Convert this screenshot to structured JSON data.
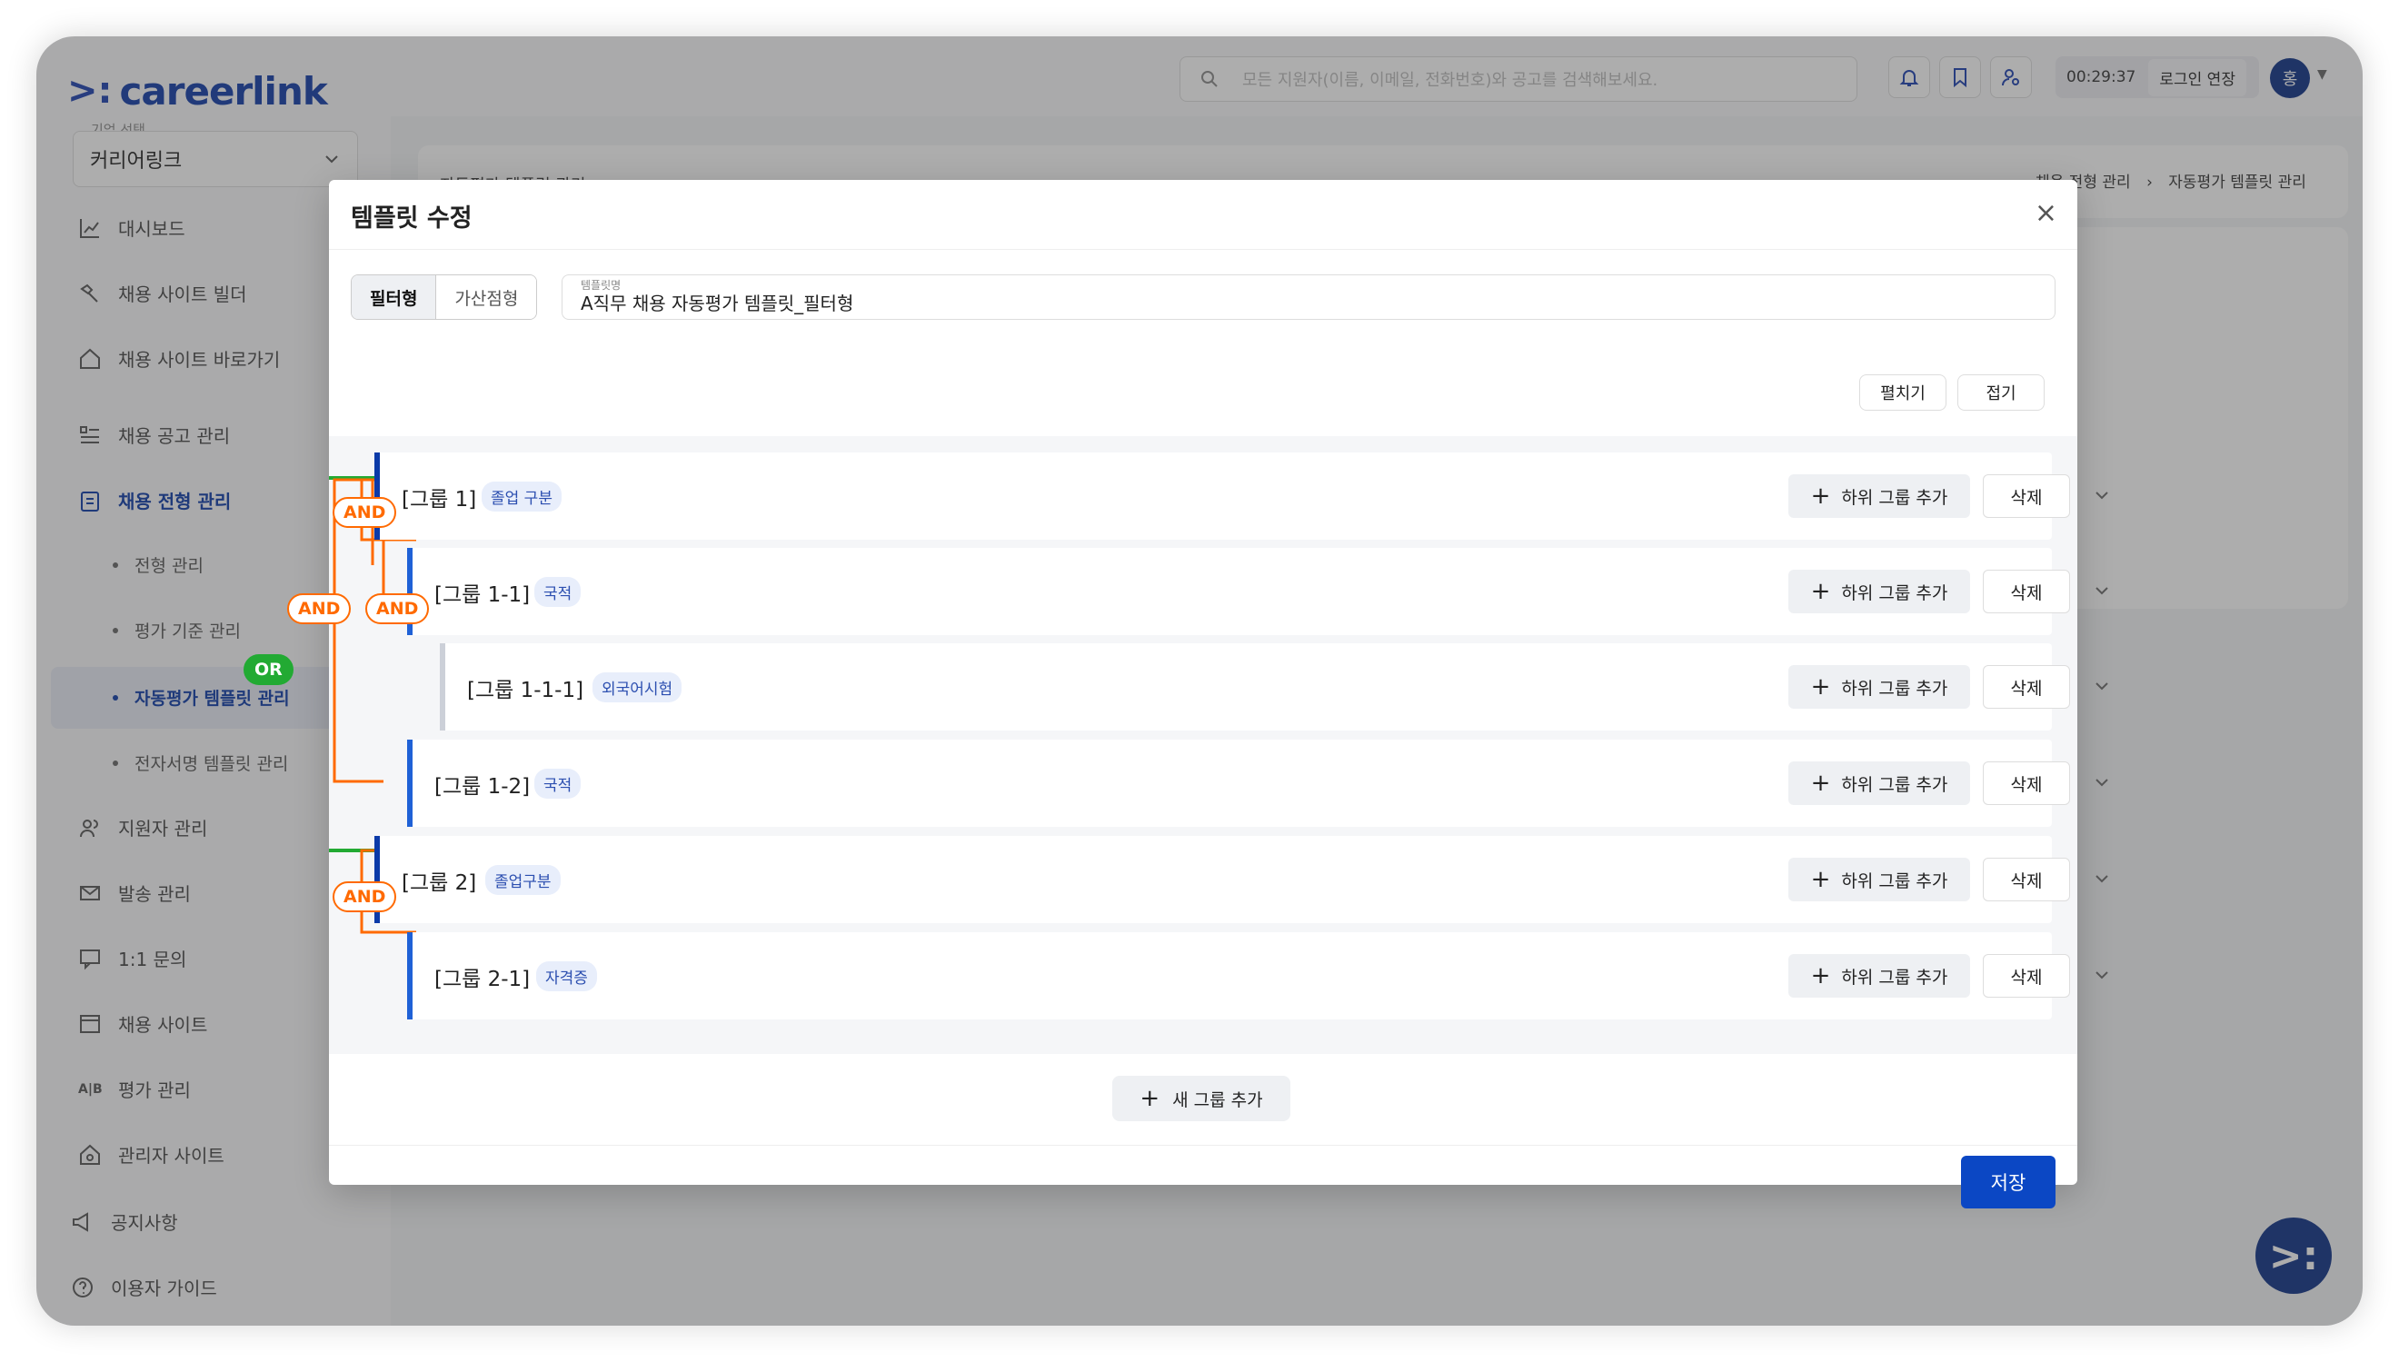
{
  "brand": {
    "logo_mark": ">:",
    "logo_text": "careerlink"
  },
  "header": {
    "search_placeholder": "모든 지원자(이름, 이메일, 전화번호)와 공고를 검색해보세요.",
    "timer": "00:29:37",
    "extend_label": "로그인 연장",
    "avatar": "홍"
  },
  "sidebar": {
    "company_label": "기업 선택",
    "company_value": "커리어링크",
    "items": [
      {
        "label": "대시보드"
      },
      {
        "label": "채용 사이트 빌더"
      },
      {
        "label": "채용 사이트 바로가기"
      },
      {
        "label": "채용 공고 관리"
      },
      {
        "label": "채용 전형 관리"
      },
      {
        "label": "지원자 관리"
      },
      {
        "label": "발송 관리"
      },
      {
        "label": "1:1 문의"
      },
      {
        "label": "채용 사이트"
      },
      {
        "label": "평가 관리"
      },
      {
        "label": "관리자 사이트"
      },
      {
        "label": "공지사항"
      },
      {
        "label": "이용자 가이드"
      }
    ],
    "sub_items": [
      {
        "label": "전형 관리"
      },
      {
        "label": "평가 기준 관리"
      },
      {
        "label": "자동평가 템플릿 관리"
      },
      {
        "label": "전자서명 템플릿 관리"
      }
    ]
  },
  "breadcrumb": {
    "item1": "채용 전형 관리",
    "item2": "자동평가 템플릿 관리"
  },
  "page_title": "자동평가 템플릿 관리",
  "modal": {
    "title": "템플릿 수정",
    "type_filter": "필터형",
    "type_score": "가산점형",
    "name_label": "템플릿명",
    "name_value": "A직무 채용 자동평가 템플릿_필터형",
    "expand_label": "펼치기",
    "collapse_label": "접기",
    "add_sub_label": "하위 그룹 추가",
    "delete_label": "삭제",
    "new_group_label": "새 그룹 추가",
    "save_label": "저장",
    "groups": [
      {
        "name": "[그룹 1]",
        "tag": "졸업 구분"
      },
      {
        "name": "[그룹 1-1]",
        "tag": "국적"
      },
      {
        "name": "[그룹 1-1-1]",
        "tag": "외국어시험"
      },
      {
        "name": "[그룹 1-2]",
        "tag": "국적"
      },
      {
        "name": "[그룹 2]",
        "tag": "졸업구분"
      },
      {
        "name": "[그룹 2-1]",
        "tag": "자격증"
      }
    ],
    "logic": {
      "and": "AND",
      "or": "OR"
    }
  },
  "colors": {
    "brand": "#0b2f86",
    "and": "#ff6a00",
    "or": "#22aa33",
    "primary": "#0b47c4"
  }
}
